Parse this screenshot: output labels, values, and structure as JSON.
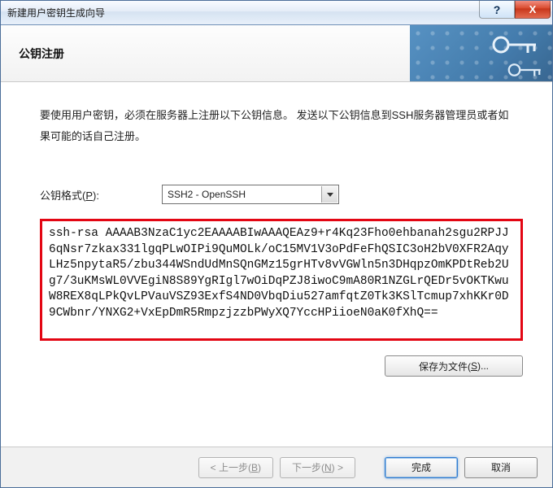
{
  "window": {
    "title": "新建用户密钥生成向导",
    "help_label": "?",
    "close_label": "X"
  },
  "banner": {
    "heading": "公钥注册"
  },
  "intro": {
    "text": "要使用用户密钥，必须在服务器上注册以下公钥信息。 发送以下公钥信息到SSH服务器管理员或者如果可能的话自己注册。"
  },
  "format": {
    "label_prefix": "公钥格式(",
    "label_hotkey": "P",
    "label_suffix": "):",
    "selected": "SSH2 - OpenSSH",
    "options": [
      "SSH2 - OpenSSH"
    ]
  },
  "pubkey": {
    "value": "ssh-rsa AAAAB3NzaC1yc2EAAAABIwAAAQEAz9+r4Kq23Fho0ehbanah2sgu2RPJJ6qNsr7zkax331lgqPLwOIPi9QuMOLk/oC15MV1V3oPdFeFhQSIC3oH2bV0XFR2AqyLHz5npytaR5/zbu344WSndUdMnSQnGMz15grHTv8vVGWln5n3DHqpzOmKPDtReb2Ug7/3uKMsWL0VVEgiN8S89YgRIgl7wOiDqPZJ8iwoC9mA80R1NZGLrQEDr5vOKTKwuW8REX8qLPkQvLPVauVSZ93ExfS4ND0VbqDiu527amfqtZ0Tk3KSlTcmup7xhKKr0D9CWbnr/YNXG2+VxEpDmR5RmpzjzzbPWyXQ7YccHPiioeN0aK0fXhQ=="
  },
  "buttons": {
    "save_prefix": "保存为文件(",
    "save_hotkey": "S",
    "save_suffix": ")...",
    "back_prefix": "< 上一步(",
    "back_hotkey": "B",
    "back_suffix": ")",
    "next_prefix": "下一步(",
    "next_hotkey": "N",
    "next_suffix": ") >",
    "finish": "完成",
    "cancel": "取消"
  }
}
